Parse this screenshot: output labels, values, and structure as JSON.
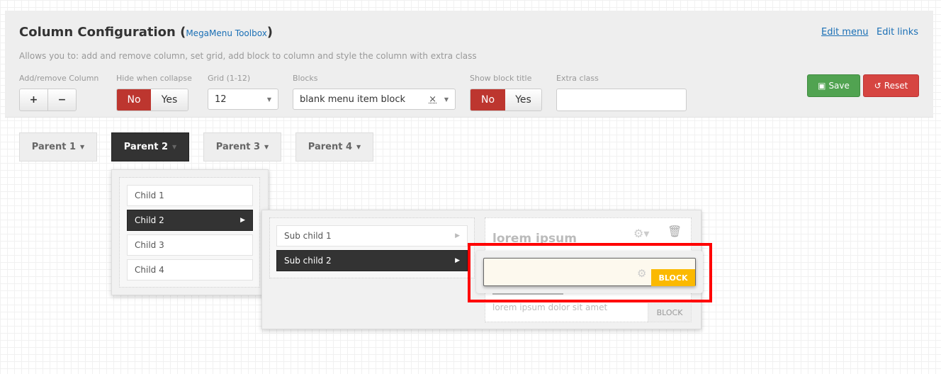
{
  "header": {
    "title": "Column Configuration",
    "title_open": "(",
    "title_link": "MegaMenu Toolbox",
    "title_close": ")",
    "description": "Allows you to: add and remove column, set grid, add block to column and style the column with extra class",
    "edit_menu": "Edit menu",
    "edit_links": "Edit links"
  },
  "controls": {
    "add_remove_label": "Add/remove Column",
    "add": "+",
    "remove": "−",
    "hide_label": "Hide when collapse",
    "hide_no": "No",
    "hide_yes": "Yes",
    "hide_selected": "No",
    "grid_label": "Grid (1-12)",
    "grid_value": "12",
    "blocks_label": "Blocks",
    "blocks_value": "blank menu item block",
    "clear": "×",
    "show_title_label": "Show block title",
    "show_no": "No",
    "show_yes": "Yes",
    "show_selected": "No",
    "extra_label": "Extra class",
    "extra_value": "",
    "save": "Save",
    "reset": "Reset"
  },
  "colors": {
    "danger": "#bd362f",
    "success": "#51a351",
    "highlight": "#ff0000",
    "badge": "#fbb900"
  },
  "menu": {
    "parents": [
      "Parent 1",
      "Parent 2",
      "Parent 3",
      "Parent 4"
    ],
    "active_parent": 1,
    "children": [
      "Child 1",
      "Child 2",
      "Child 3",
      "Child 4"
    ],
    "active_child": 1,
    "sub_children": [
      "Sub child 1",
      "Sub child 2"
    ],
    "active_sub": 1
  },
  "block": {
    "title": "lorem ipsum",
    "text": "lorem ipsum dolor sit amet",
    "label": "BLOCK",
    "drag_label": "BLOCK"
  }
}
